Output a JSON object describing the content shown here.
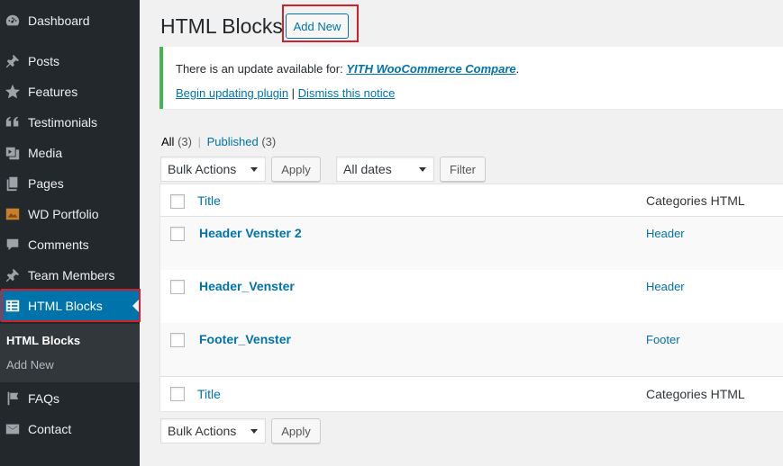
{
  "sidebar": {
    "items": [
      {
        "label": "Dashboard",
        "icon": "dashboard-icon"
      },
      {
        "label": "Posts",
        "icon": "pin-icon"
      },
      {
        "label": "Features",
        "icon": "star-icon"
      },
      {
        "label": "Testimonials",
        "icon": "quote-icon"
      },
      {
        "label": "Media",
        "icon": "media-icon"
      },
      {
        "label": "Pages",
        "icon": "pages-icon"
      },
      {
        "label": "WD Portfolio",
        "icon": "portfolio-icon"
      },
      {
        "label": "Comments",
        "icon": "comment-icon"
      },
      {
        "label": "Team Members",
        "icon": "pin-icon"
      },
      {
        "label": "HTML Blocks",
        "icon": "table-icon",
        "active": true
      },
      {
        "label": "FAQs",
        "icon": "flag-icon"
      },
      {
        "label": "Contact",
        "icon": "mail-icon"
      }
    ],
    "submenu": [
      {
        "label": "HTML Blocks",
        "current": true
      },
      {
        "label": "Add New"
      }
    ]
  },
  "header": {
    "title": "HTML Blocks",
    "add_new_label": "Add New"
  },
  "notice": {
    "prefix": "There is an update available for: ",
    "plugin_name": "YITH WooCommerce Compare",
    "suffix": ".",
    "begin_link": "Begin updating plugin",
    "separator": " | ",
    "dismiss_link": "Dismiss this notice"
  },
  "filters": {
    "all_label": "All",
    "all_count": "(3)",
    "published_label": "Published",
    "published_count": "(3)",
    "divider": "|"
  },
  "tablenav_top": {
    "bulk_actions": "Bulk Actions",
    "apply": "Apply",
    "date_filter": "All dates",
    "filter": "Filter"
  },
  "table": {
    "col_title": "Title",
    "col_categories": "Categories HTML",
    "rows": [
      {
        "title": "Header Venster 2",
        "category": "Header"
      },
      {
        "title": "Header_Venster",
        "category": "Header"
      },
      {
        "title": "Footer_Venster",
        "category": "Footer"
      }
    ]
  },
  "tablenav_bottom": {
    "bulk_actions": "Bulk Actions",
    "apply": "Apply"
  },
  "colors": {
    "sidebar_bg": "#23282d",
    "active_bg": "#0073aa",
    "link": "#0073aa",
    "highlight_border": "#d3202a",
    "notice_border": "#46b450"
  }
}
